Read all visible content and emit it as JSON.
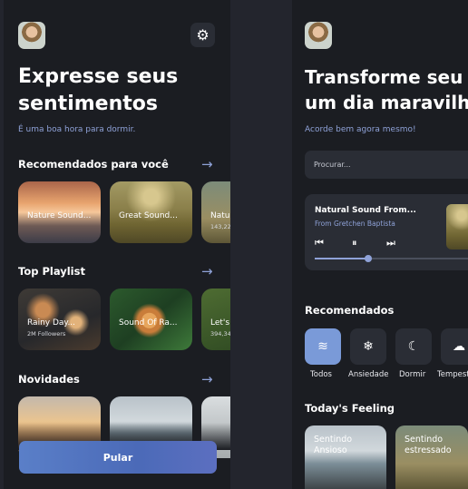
{
  "left": {
    "title_line1": "Expresse seus",
    "title_line2": "sentimentos",
    "subtitle": "É uma boa hora para dormir.",
    "recommended": {
      "title": "Recomendados para você",
      "arrow": "→",
      "cards": [
        {
          "title": "Nature Sound...",
          "sub": ""
        },
        {
          "title": "Great Sound...",
          "sub": ""
        },
        {
          "title": "Natu",
          "sub": "143,22..."
        }
      ]
    },
    "playlists": {
      "title": "Top Playlist",
      "arrow": "→",
      "cards": [
        {
          "title": "Rainy Day...",
          "sub": "2M Followers"
        },
        {
          "title": "Sound Of Ra...",
          "sub": ""
        },
        {
          "title": "Let's",
          "sub": "394,34..."
        }
      ]
    },
    "news": {
      "title": "Novidades",
      "arrow": "→"
    },
    "button_label": "Pular",
    "gear_icon": "⚙"
  },
  "right": {
    "title_line1": "Transforme seu dia",
    "title_line2": "um dia maravilhoso",
    "subtitle": "Acorde bem agora mesmo!",
    "search_placeholder": "Procurar...",
    "player": {
      "title": "Natural Sound From...",
      "artist": "From Gretchen Baptista",
      "prev": "⏮",
      "pause": "⏸",
      "next": "⏭",
      "progress": 0.33
    },
    "recommended_title": "Recomendados",
    "categories": [
      {
        "label": "Todos",
        "icon": "≋",
        "active": true
      },
      {
        "label": "Ansiedade",
        "icon": "❄",
        "active": false
      },
      {
        "label": "Dormir",
        "icon": "☾",
        "active": false
      },
      {
        "label": "Tempest",
        "icon": "☁",
        "active": false
      }
    ],
    "feeling_title": "Today's Feeling",
    "feelings": [
      {
        "line1": "Sentindo",
        "line2": "Ansioso"
      },
      {
        "line1": "Sentindo",
        "line2": "estressado"
      }
    ]
  }
}
